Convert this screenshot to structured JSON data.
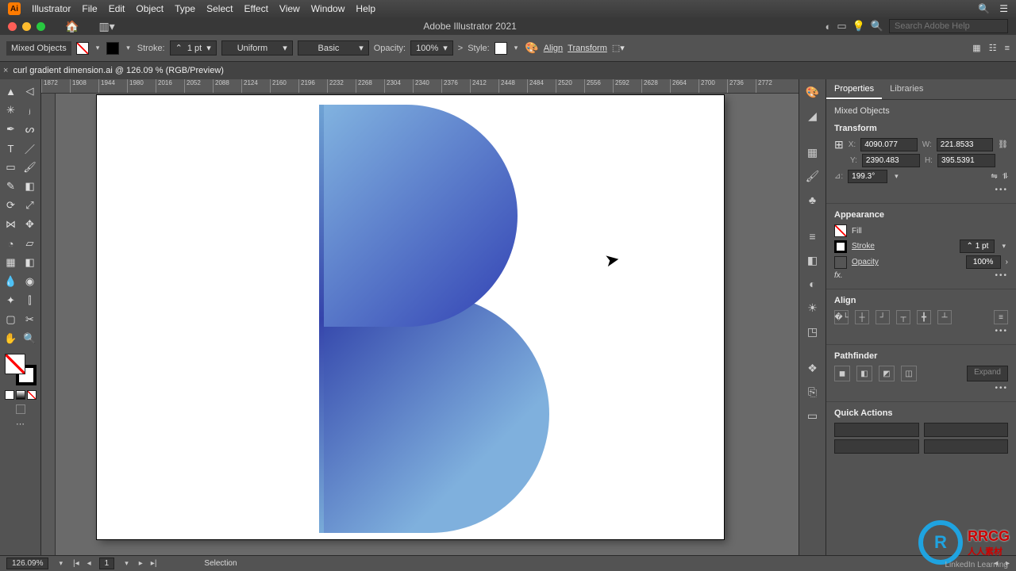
{
  "menu": {
    "app": "Illustrator",
    "items": [
      "File",
      "Edit",
      "Object",
      "Type",
      "Select",
      "Effect",
      "View",
      "Window",
      "Help"
    ]
  },
  "window": {
    "title": "Adobe Illustrator 2021",
    "search_placeholder": "Search Adobe Help"
  },
  "ctrl": {
    "selection": "Mixed Objects",
    "stroke_label": "Stroke:",
    "stroke_val": "1 pt",
    "profile": "Uniform",
    "brush": "Basic",
    "opacity_label": "Opacity:",
    "opacity_val": "100%",
    "style_label": "Style:",
    "align": "Align",
    "transform": "Transform"
  },
  "doc": {
    "close": "×",
    "name": "curl gradient dimension.ai @ 126.09 % (RGB/Preview)"
  },
  "ruler_ticks": [
    "1872",
    "1908",
    "1944",
    "1980",
    "2016",
    "2052",
    "2088",
    "2124",
    "2160",
    "2196",
    "2232",
    "2268",
    "2304",
    "2340",
    "2376",
    "2412",
    "2448",
    "2484",
    "2520",
    "2556",
    "2592",
    "2628",
    "2664",
    "2700",
    "2736",
    "2772"
  ],
  "props": {
    "tabs": [
      "Properties",
      "Libraries"
    ],
    "sel": "Mixed Objects",
    "transform": {
      "title": "Transform",
      "x_label": "X:",
      "x": "4090.077",
      "w_label": "W:",
      "w": "221.8533",
      "y_label": "Y:",
      "y": "2390.483",
      "h_label": "H:",
      "h": "395.5391",
      "angle_label": "⊿:",
      "angle": "199.3°"
    },
    "appearance": {
      "title": "Appearance",
      "fill_label": "Fill",
      "stroke_label": "Stroke",
      "stroke_val": "1 pt",
      "opacity_label": "Opacity",
      "opacity_val": "100%",
      "fx": "fx."
    },
    "align": {
      "title": "Align"
    },
    "pathfinder": {
      "title": "Pathfinder",
      "expand": "Expand"
    },
    "quick": {
      "title": "Quick Actions"
    }
  },
  "status": {
    "zoom": "126.09%",
    "page": "1",
    "mode": "Selection"
  },
  "watermark": {
    "brand": "RRCG",
    "sub": "人人素材",
    "credit": "LinkedIn Learning"
  }
}
